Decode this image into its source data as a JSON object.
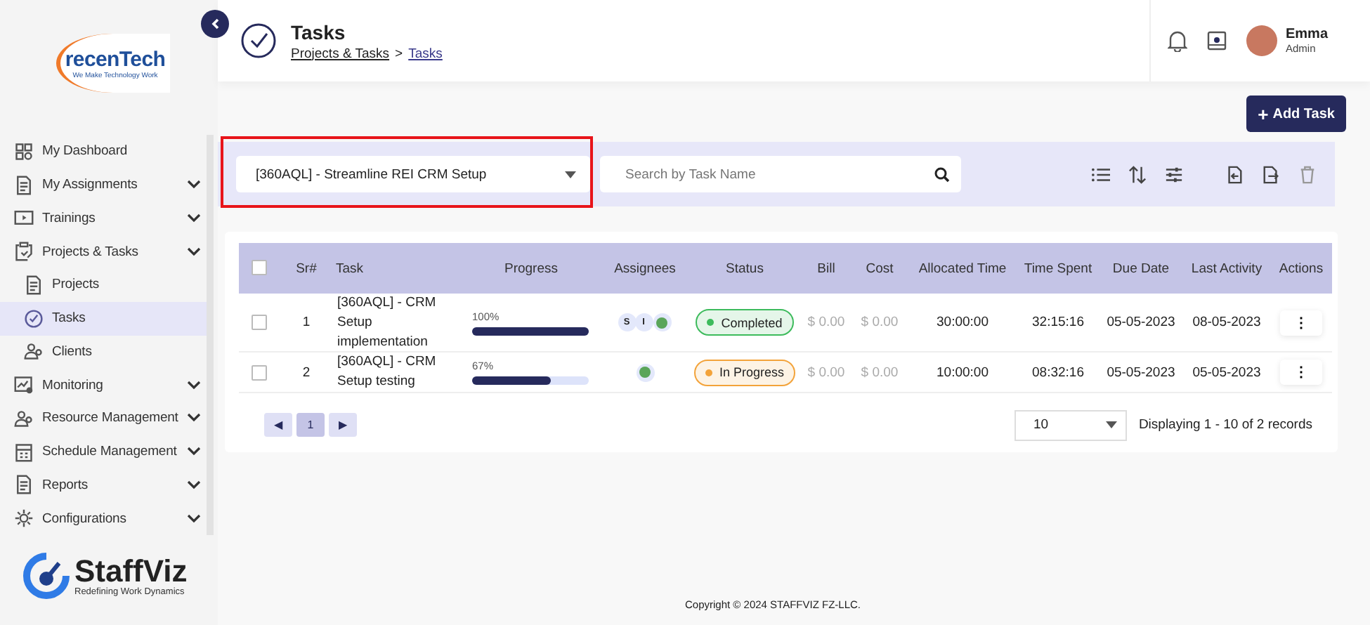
{
  "sidebar": {
    "logo": {
      "name": "recenTech",
      "tagline": "We Make Technology Work"
    },
    "items": [
      {
        "label": "My Dashboard",
        "has_submenu": false,
        "selected": false
      },
      {
        "label": "My Assignments",
        "has_submenu": true,
        "selected": false
      },
      {
        "label": "Trainings",
        "has_submenu": true,
        "selected": false
      },
      {
        "label": "Projects & Tasks",
        "has_submenu": true,
        "selected": false,
        "children": [
          {
            "label": "Projects",
            "has_submenu": false,
            "selected": false
          },
          {
            "label": "Tasks",
            "has_submenu": false,
            "selected": true
          },
          {
            "label": "Clients",
            "has_submenu": false,
            "selected": false
          }
        ]
      },
      {
        "label": "Monitoring",
        "has_submenu": true,
        "selected": false
      },
      {
        "label": "Resource Management",
        "has_submenu": true,
        "selected": false
      },
      {
        "label": "Schedule Management",
        "has_submenu": true,
        "selected": false
      },
      {
        "label": "Reports",
        "has_submenu": true,
        "selected": false
      },
      {
        "label": "Configurations",
        "has_submenu": true,
        "selected": false
      }
    ],
    "brand": {
      "name": "StaffViz",
      "tagline": "Redefining Work Dynamics"
    }
  },
  "header": {
    "title": "Tasks",
    "breadcrumb": [
      "Projects & Tasks",
      "Tasks"
    ],
    "separator": ">",
    "user": {
      "name": "Emma",
      "role": "Admin"
    }
  },
  "add_button": {
    "label": "Add Task",
    "icon": "+"
  },
  "toolbar": {
    "project_select": {
      "value": "[360AQL] - Streamline REI CRM Setup",
      "highlighted": true
    },
    "search": {
      "placeholder": "Search by Task Name"
    }
  },
  "table": {
    "columns": [
      "Sr#",
      "Task",
      "Progress",
      "Assignees",
      "Status",
      "Bill",
      "Cost",
      "Allocated Time",
      "Time Spent",
      "Due Date",
      "Last Activity",
      "Actions"
    ],
    "select_all": {
      "checked": false
    },
    "rows": [
      {
        "checked": false,
        "sr": "1",
        "task": "[360AQL] - CRM Setup implementation",
        "progress": {
          "level": 1,
          "reading": "100%"
        },
        "assignees": [
          {
            "kind": "initial",
            "label": "S"
          },
          {
            "kind": "initial",
            "label": "I"
          },
          {
            "kind": "avatar"
          }
        ],
        "status": {
          "label": "Completed",
          "color": "#3dbb5c"
        },
        "bill": "$ 0.00",
        "cost": "$ 0.00",
        "allocated_time": "30:00:00",
        "time_spent": "32:15:16",
        "due_date": "05-05-2023",
        "last_activity": "08-05-2023",
        "actions": "⋮"
      },
      {
        "checked": false,
        "sr": "2",
        "task": "[360AQL] - CRM Setup testing",
        "progress": {
          "level": 0.67,
          "reading": "67%"
        },
        "assignees": [
          {
            "kind": "avatar"
          }
        ],
        "status": {
          "label": "In Progress",
          "color": "#f3a33a"
        },
        "bill": "$ 0.00",
        "cost": "$ 0.00",
        "allocated_time": "10:00:00",
        "time_spent": "08:32:16",
        "due_date": "05-05-2023",
        "last_activity": "05-05-2023",
        "actions": "⋮"
      }
    ]
  },
  "pagination": {
    "prev": "◀",
    "pages": [
      {
        "label": "1",
        "selected": true
      }
    ],
    "next": "▶",
    "page_size": "10",
    "summary": "Displaying 1 - 10 of 2 records"
  },
  "footer": "Copyright © 2024 STAFFVIZ FZ-LLC."
}
